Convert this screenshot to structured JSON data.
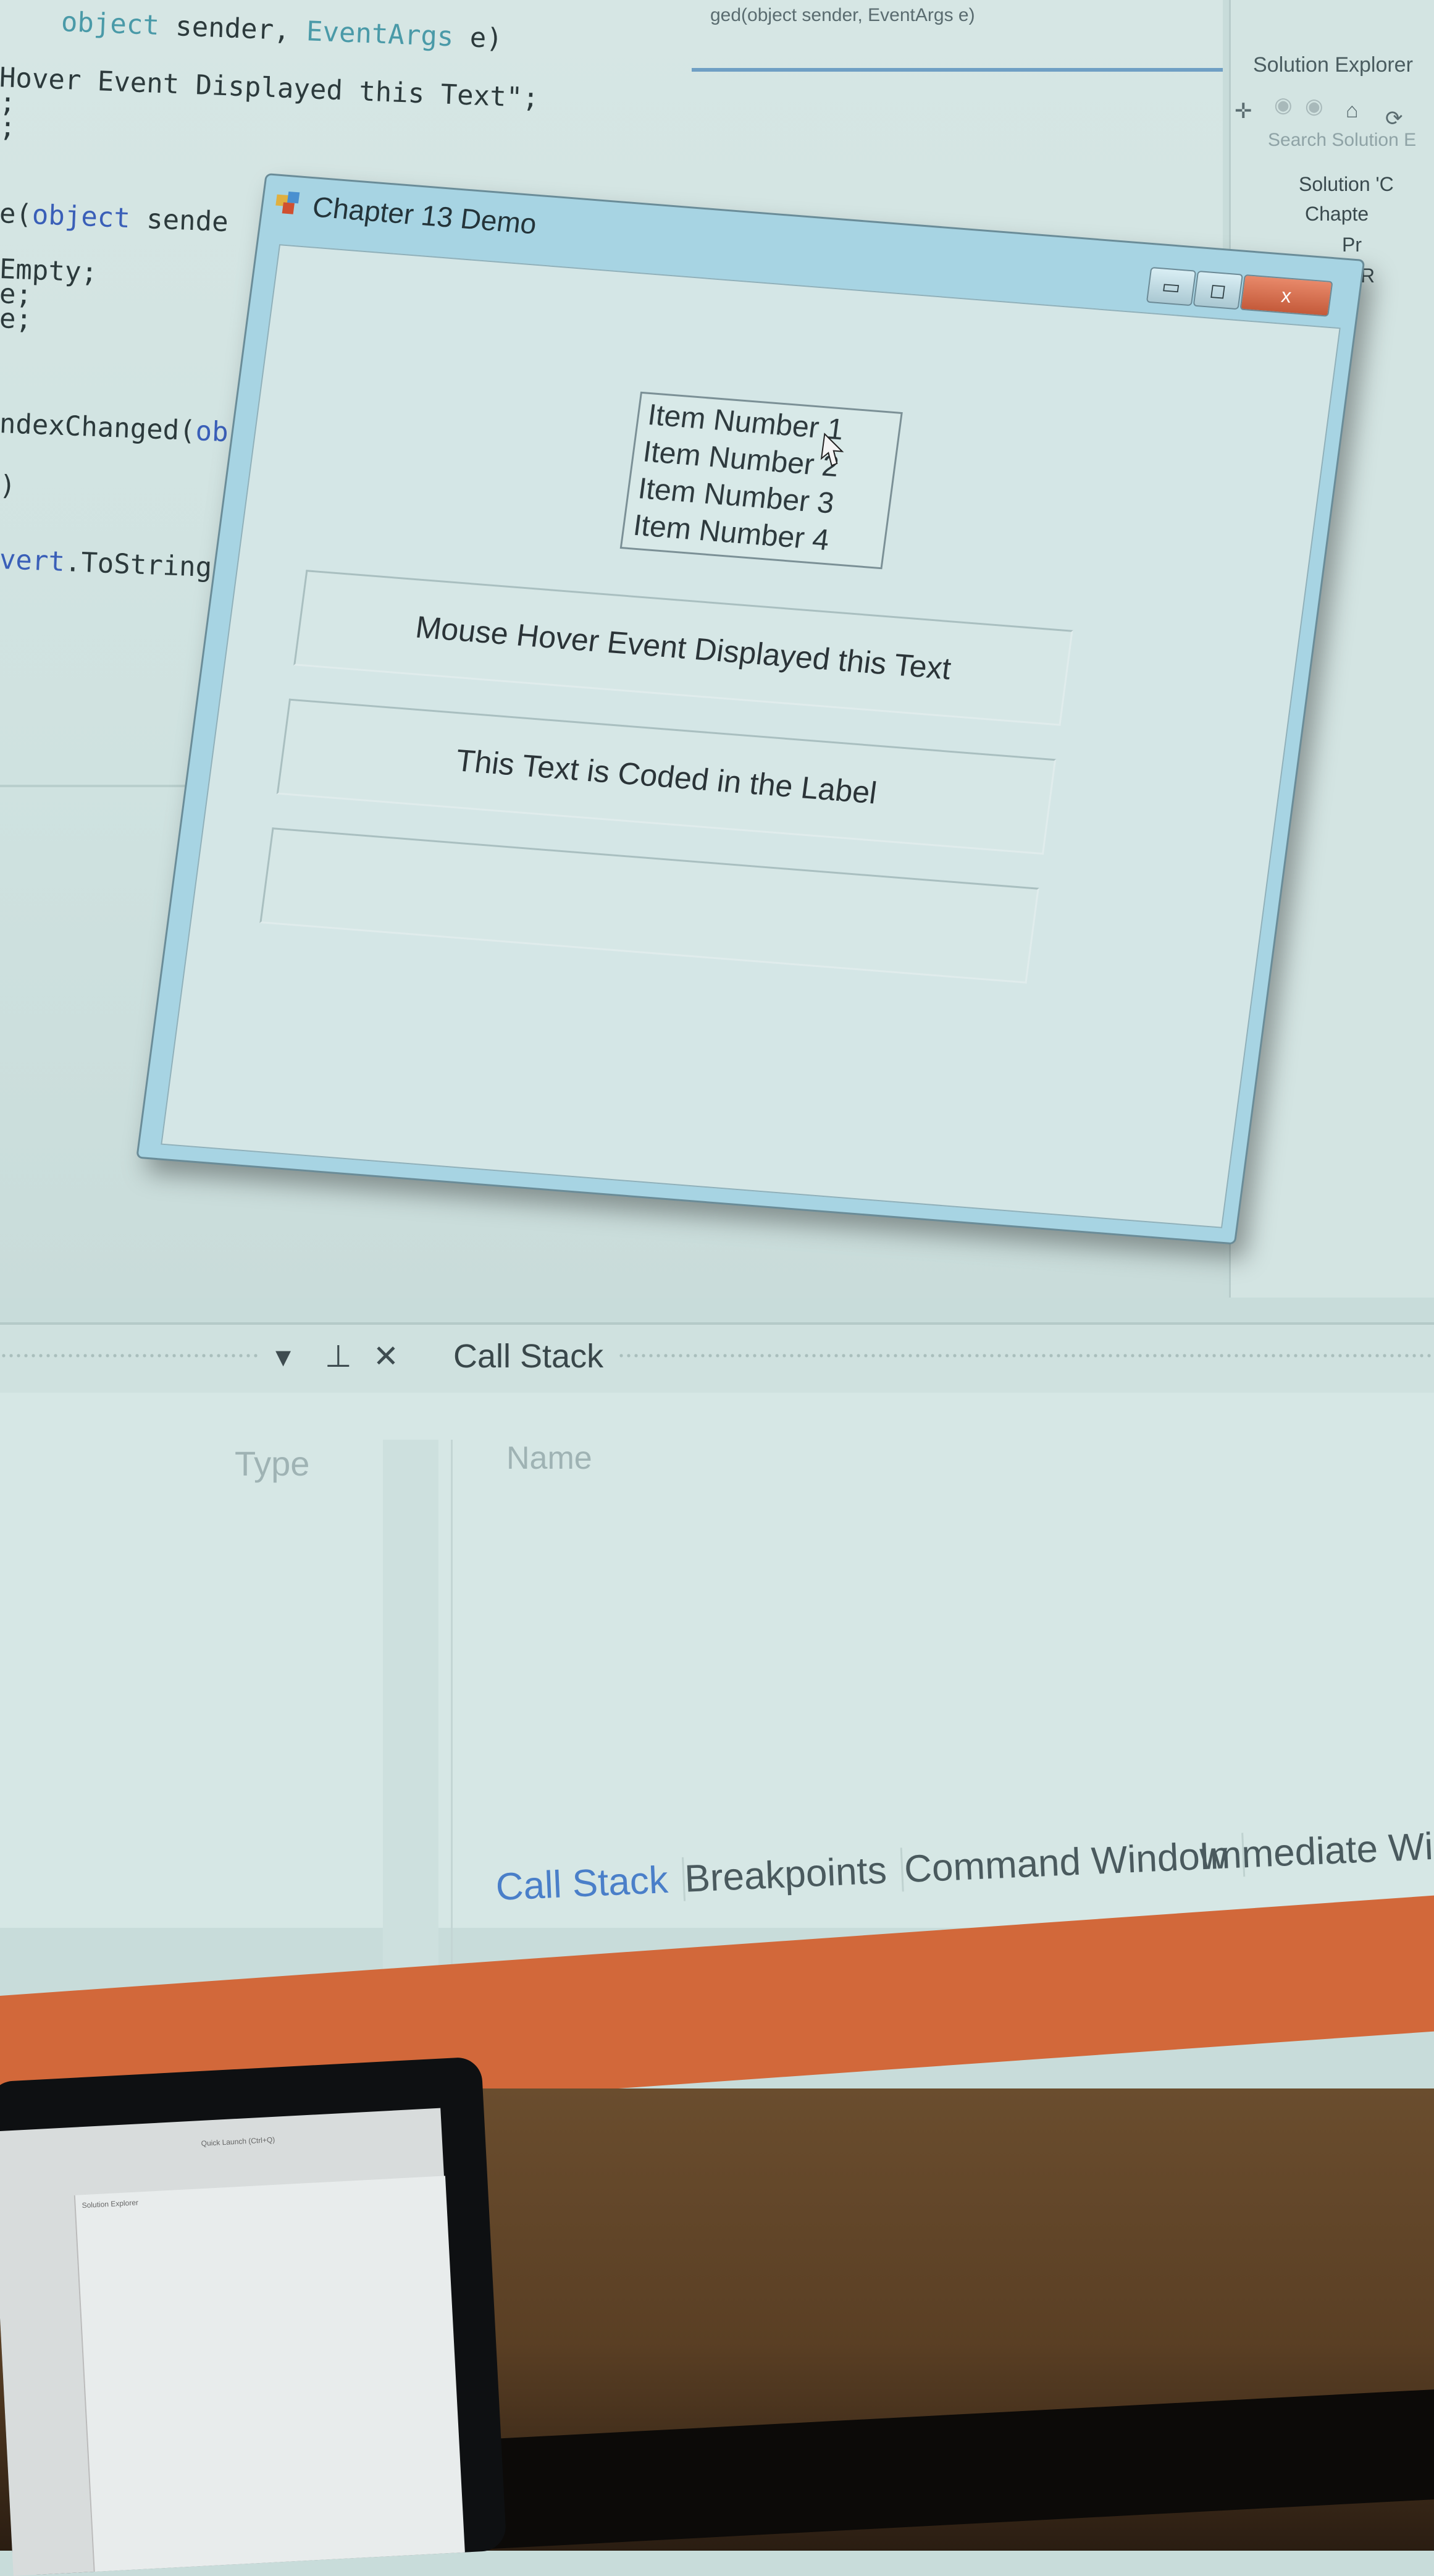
{
  "editor": {
    "tab_text": "ged(object sender, EventArgs e)",
    "code_lines": [
      {
        "parts": [
          [
            "ty",
            "object"
          ],
          [
            "str",
            " sender, "
          ],
          [
            "ty",
            "EventArgs"
          ],
          [
            "str",
            " e)"
          ]
        ]
      },
      {
        "parts": [
          [
            "str",
            "Hover Event Displayed this Text\";"
          ]
        ]
      },
      {
        "parts": [
          [
            "str",
            ";"
          ]
        ]
      },
      {
        "parts": [
          [
            "str",
            ";"
          ]
        ]
      },
      {
        "parts": [
          [
            "str",
            "e("
          ],
          [
            "kw",
            "object"
          ],
          [
            "str",
            " sende"
          ]
        ]
      },
      {
        "parts": [
          [
            "str",
            "Empty;"
          ]
        ]
      },
      {
        "parts": [
          [
            "str",
            "e;"
          ]
        ]
      },
      {
        "parts": [
          [
            "str",
            "e;"
          ]
        ]
      },
      {
        "parts": [
          [
            "str",
            "ndexChanged("
          ],
          [
            "kw",
            "ob"
          ]
        ]
      },
      {
        "parts": [
          [
            "str",
            ")"
          ]
        ]
      },
      {
        "parts": [
          [
            "kw",
            "vert"
          ],
          [
            "str",
            ".ToString("
          ]
        ]
      }
    ]
  },
  "solution_explorer": {
    "title": "Solution Explorer",
    "search_placeholder": "Search Solution E",
    "nodes": [
      "Solution 'C",
      "Chapte",
      "Pr",
      "R"
    ]
  },
  "demo_window": {
    "title": "Chapter 13 Demo",
    "minimize_glyph": "▭",
    "maximize_glyph": "◻",
    "close_glyph": "x",
    "list_items": [
      "Item Number 1",
      "Item Number 2",
      "Item Number 3",
      "Item Number 4"
    ],
    "label_hover": "Mouse Hover Event Displayed this Text",
    "label_coded": "This Text is Coded in the Label",
    "label_empty": ""
  },
  "bottom_panel": {
    "title": "Call Stack",
    "left_column_header": "Type",
    "right_column_header": "Name",
    "tabs": [
      "Call Stack",
      "Breakpoints",
      "Command Window",
      "Immediate Wind"
    ]
  },
  "laptop_screen": {
    "quick_launch": "Quick Launch (Ctrl+Q)",
    "solution_explorer": "Solution Explorer"
  }
}
